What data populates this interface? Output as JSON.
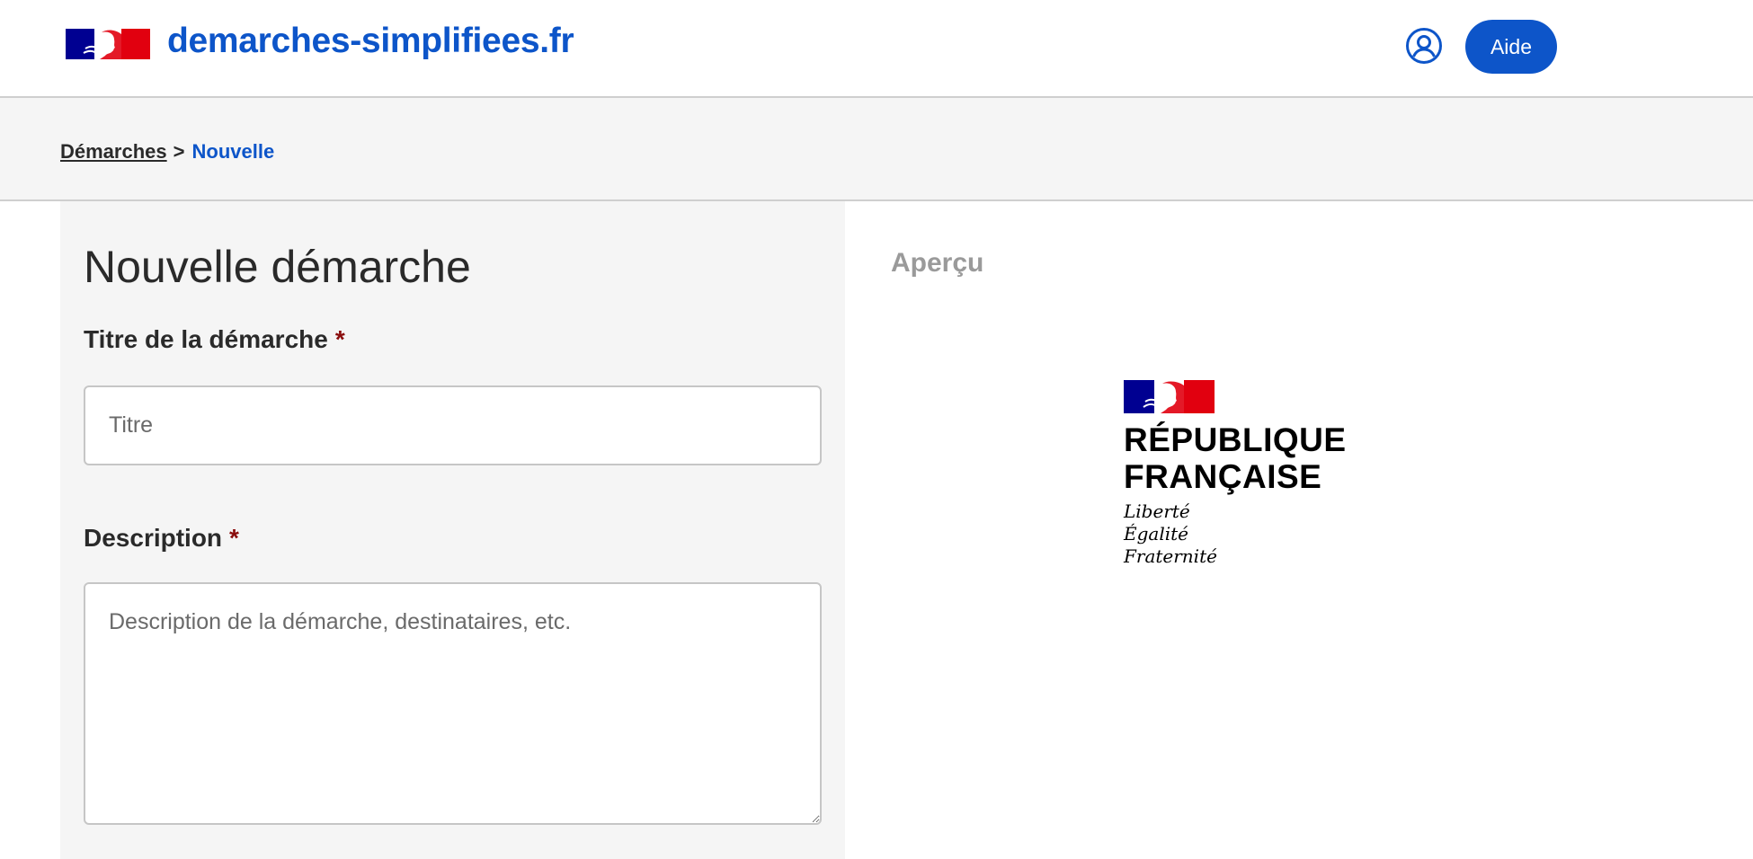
{
  "header": {
    "site_name": "demarches-simplifiees.fr",
    "help_label": "Aide"
  },
  "breadcrumb": {
    "parent": "Démarches",
    "separator": ">",
    "current": "Nouvelle"
  },
  "form": {
    "title": "Nouvelle démarche",
    "title_field": {
      "label": "Titre de la démarche",
      "required_mark": "*",
      "placeholder": "Titre",
      "value": ""
    },
    "description_field": {
      "label": "Description",
      "required_mark": "*",
      "placeholder": "Description de la démarche, destinataires, etc.",
      "value": ""
    }
  },
  "preview": {
    "title": "Aperçu",
    "logo_lines": [
      "RÉPUBLIQUE",
      "FRANÇAISE"
    ],
    "motto": [
      "Liberté",
      "Égalité",
      "Fraternité"
    ]
  },
  "colors": {
    "primary": "#0d55c9",
    "flag_blue": "#000091",
    "flag_red": "#e1000f",
    "required": "#8a0d0d",
    "panel_bg": "#f5f5f5"
  },
  "icons": {
    "user": "user-circle-icon",
    "brand": "marianne-flag-icon"
  }
}
